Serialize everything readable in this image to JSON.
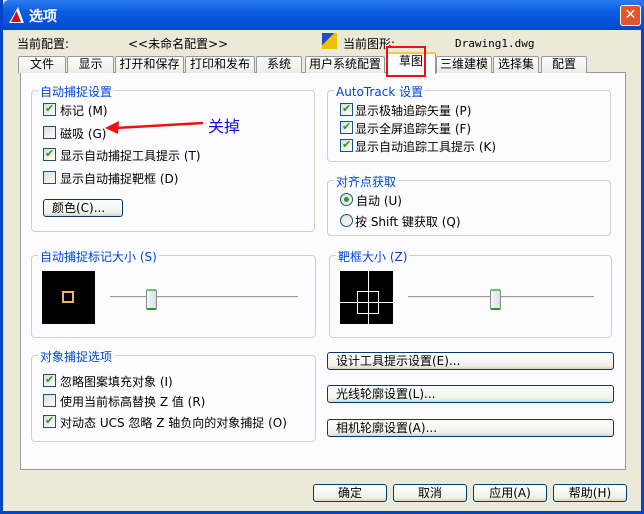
{
  "window": {
    "title": "选项",
    "close_icon": "close-icon"
  },
  "profile": {
    "label": "当前配置:",
    "value": "<<未命名配置>>",
    "drawing_label": "当前图形:",
    "drawing_value": "Drawing1.dwg"
  },
  "tabs": [
    "文件",
    "显示",
    "打开和保存",
    "打印和发布",
    "系统",
    "用户系统配置",
    "草图",
    "三维建模",
    "选择集",
    "配置"
  ],
  "selected_tab": "草图",
  "autosnap": {
    "title": "自动捕捉设置",
    "items": [
      {
        "label": "标记 (M)",
        "checked": true
      },
      {
        "label": "磁吸 (G)",
        "checked": false
      },
      {
        "label": "显示自动捕捉工具提示 (T)",
        "checked": true
      },
      {
        "label": "显示自动捕捉靶框 (D)",
        "checked": false
      }
    ],
    "color_button": "颜色(C)..."
  },
  "annotation": {
    "text": "关掉",
    "color": "#1010E0"
  },
  "autotrack": {
    "title": "AutoTrack 设置",
    "items": [
      {
        "label": "显示极轴追踪矢量 (P)",
        "checked": true
      },
      {
        "label": "显示全屏追踪矢量 (F)",
        "checked": true
      },
      {
        "label": "显示自动追踪工具提示 (K)",
        "checked": true
      }
    ]
  },
  "alignment": {
    "title": "对齐点获取",
    "options": [
      {
        "label": "自动 (U)",
        "selected": true
      },
      {
        "label": "按 Shift 键获取 (Q)",
        "selected": false
      }
    ]
  },
  "marker_size": {
    "title": "自动捕捉标记大小 (S)",
    "slider_percent": 22
  },
  "aperture_size": {
    "title": "靶框大小 (Z)",
    "slider_percent": 47
  },
  "osnap_options": {
    "title": "对象捕捉选项",
    "items": [
      {
        "label": "忽略图案填充对象 (I)",
        "checked": true
      },
      {
        "label": "使用当前标高替换 Z 值 (R)",
        "checked": false
      },
      {
        "label": "对动态 UCS 忽略 Z 轴负向的对象捕捉 (O)",
        "checked": true
      }
    ]
  },
  "side_buttons": [
    "设计工具提示设置(E)...",
    "光线轮廓设置(L)...",
    "相机轮廓设置(A)..."
  ],
  "footer": {
    "ok": "确定",
    "cancel": "取消",
    "apply": "应用(A)",
    "help": "帮助(H)"
  }
}
